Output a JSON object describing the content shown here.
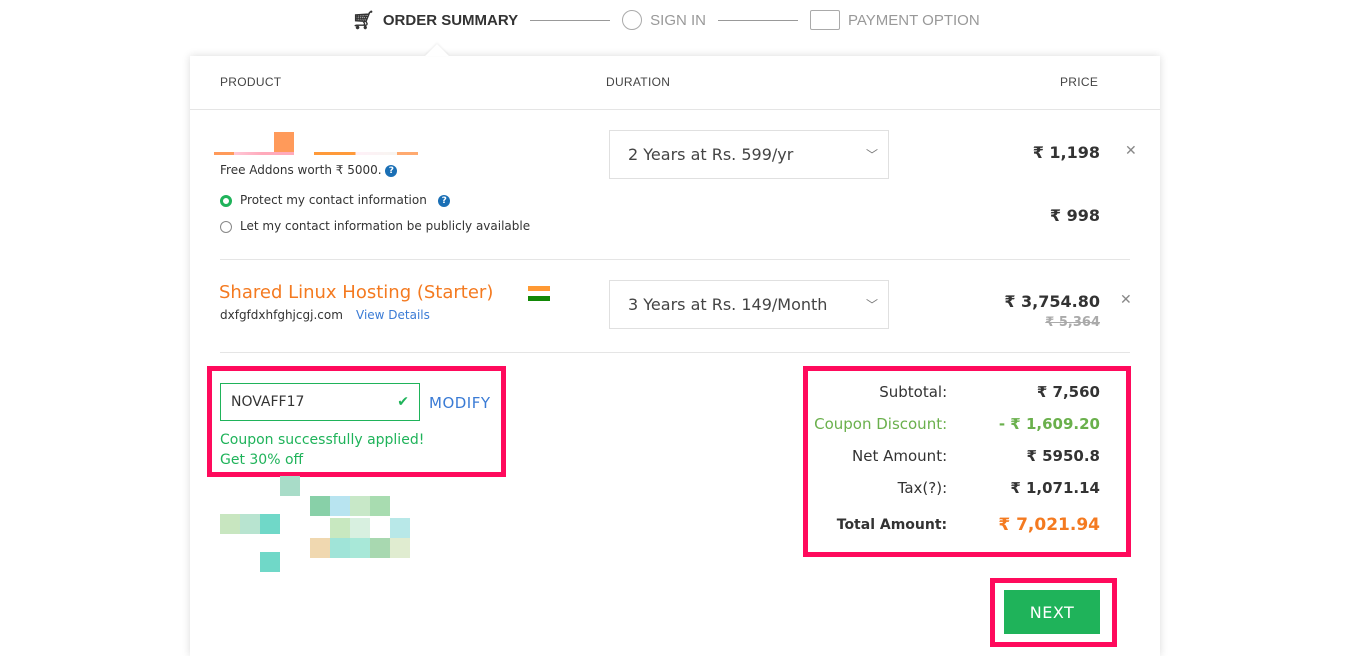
{
  "steps": [
    {
      "label": "ORDER SUMMARY",
      "icon": "cart-icon",
      "active": true
    },
    {
      "label": "SIGN IN",
      "icon": "user-icon"
    },
    {
      "label": "PAYMENT OPTION",
      "icon": "card-icon"
    }
  ],
  "table": {
    "headers": {
      "product": "PRODUCT",
      "duration": "DURATION",
      "price": "PRICE"
    }
  },
  "items": [
    {
      "addons": "Free Addons worth ₹ 5000.",
      "options": [
        "Protect my contact information",
        "Let my contact information be publicly available"
      ],
      "selected_option": 0,
      "duration": "2 Years at Rs. 599/yr",
      "price": "₹ 1,198",
      "addon_price": "₹ 998"
    },
    {
      "name": "Shared Linux Hosting (Starter)",
      "domain": "dxfgfdxhfghjcgj.com",
      "view_details": "View Details",
      "duration": "3 Years at Rs. 149/Month",
      "price": "₹ 3,754.80",
      "old_price": "₹ 5,364"
    }
  ],
  "coupon": {
    "value": "NOVAFF17",
    "modify": "MODIFY",
    "success": "Coupon successfully applied!",
    "offer": "Get 30% off"
  },
  "summary": {
    "subtotal_label": "Subtotal:",
    "subtotal": "₹ 7,560",
    "discount_label": "Coupon Discount:",
    "discount": "- ₹ 1,609.20",
    "net_label": "Net Amount:",
    "net": "₹ 5950.8",
    "tax_label": "Tax(?):",
    "tax": "₹ 1,071.14",
    "total_label": "Total Amount:",
    "total": "₹ 7,021.94"
  },
  "next_label": "NEXT",
  "colors": {
    "accent": "#f47a20",
    "green": "#1fb35a",
    "highlight": "#ff0a5c",
    "link": "#3a7bd5"
  }
}
